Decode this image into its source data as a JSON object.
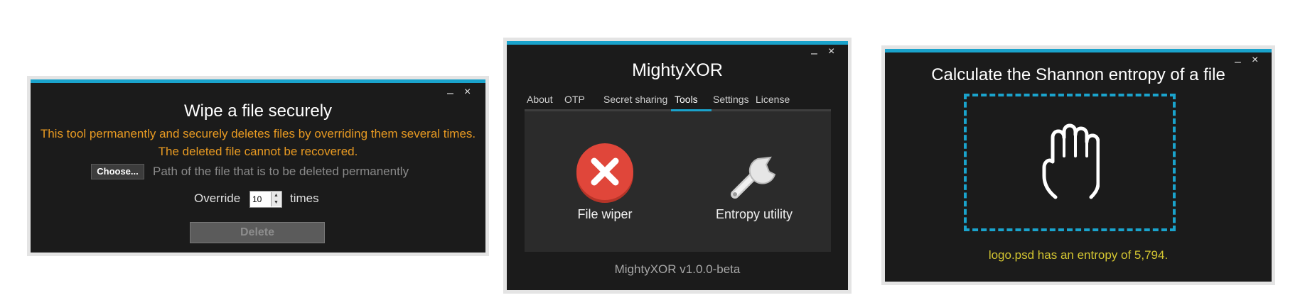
{
  "wipe_window": {
    "controls": {
      "minimize": "–",
      "close": "×"
    },
    "title": "Wipe a file securely",
    "description_line1": "This tool permanently and securely deletes files by overriding them several times.",
    "description_line2": "The deleted file cannot be recovered.",
    "choose_button": "Choose...",
    "path_placeholder": "Path of the file that is to be deleted permanently",
    "override_label": "Override",
    "override_value": "10",
    "times_label": "times",
    "delete_button": "Delete"
  },
  "main_window": {
    "controls": {
      "minimize": "–",
      "close": "×"
    },
    "title": "MightyXOR",
    "tabs": [
      {
        "label": "About"
      },
      {
        "label": "OTP"
      },
      {
        "label": "Secret sharing"
      },
      {
        "label": "Tools",
        "selected": true
      },
      {
        "label": "Settings"
      },
      {
        "label": "License"
      }
    ],
    "tools": [
      {
        "label": "File wiper",
        "icon": "delete-x-icon"
      },
      {
        "label": "Entropy utility",
        "icon": "wrench-icon"
      }
    ],
    "version": "MightyXOR v1.0.0-beta"
  },
  "entropy_window": {
    "controls": {
      "minimize": "–",
      "close": "×"
    },
    "title": "Calculate the Shannon entropy of a file",
    "drop_icon": "hand-icon",
    "result": "logo.psd has an entropy of 5,794."
  },
  "colors": {
    "accent": "#1aa3cc",
    "window_bg": "#1b1b1b",
    "warning_text": "#e89a22",
    "result_text": "#d3c531",
    "danger_red": "#e0463a"
  }
}
